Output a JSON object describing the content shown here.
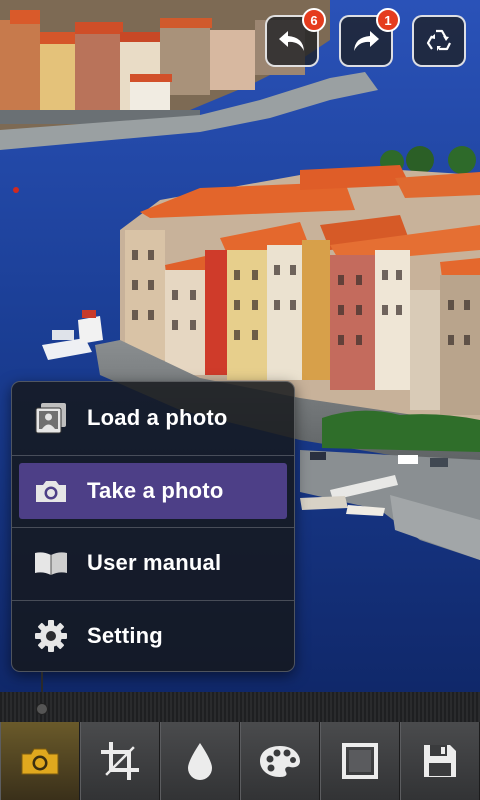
{
  "top_controls": {
    "undo": {
      "icon": "undo-icon",
      "badge": "6"
    },
    "redo": {
      "icon": "redo-icon",
      "badge": "1"
    },
    "reset": {
      "icon": "recycle-icon"
    }
  },
  "menu": {
    "items": [
      {
        "label": "Load a photo",
        "icon": "photo-album-icon",
        "selected": false
      },
      {
        "label": "Take a photo",
        "icon": "camera-icon",
        "selected": true
      },
      {
        "label": "User manual",
        "icon": "book-icon",
        "selected": false
      },
      {
        "label": "Setting",
        "icon": "gear-icon",
        "selected": false
      }
    ]
  },
  "toolbar": {
    "tools": [
      {
        "name": "camera",
        "icon": "camera-icon",
        "active": true
      },
      {
        "name": "crop",
        "icon": "crop-icon",
        "active": false
      },
      {
        "name": "color",
        "icon": "droplet-icon",
        "active": false
      },
      {
        "name": "effects",
        "icon": "palette-icon",
        "active": false
      },
      {
        "name": "frame",
        "icon": "frame-icon",
        "active": false
      },
      {
        "name": "save",
        "icon": "save-icon",
        "active": false
      }
    ]
  },
  "colors": {
    "accent_selected": "#4d3f87",
    "badge": "#e53c1e",
    "active_tool_icon": "#e0a81e",
    "river": "#1a3d93"
  }
}
